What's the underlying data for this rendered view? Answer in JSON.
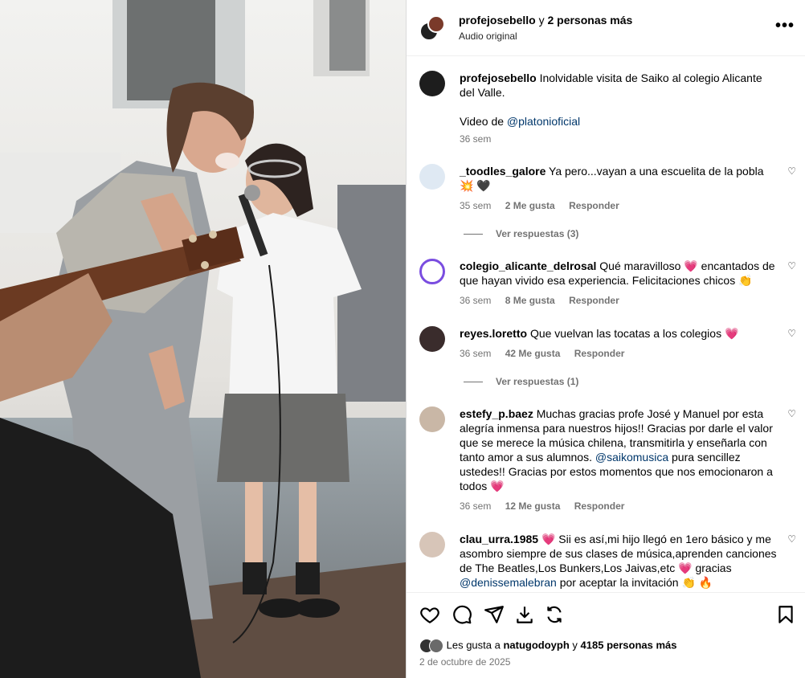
{
  "header": {
    "username": "profejosebello",
    "and_more": "y",
    "others": "2 personas más",
    "subtitle": "Audio original",
    "more_icon": "more-horizontal-icon"
  },
  "caption": {
    "username": "profejosebello",
    "text": "Inolvidable visita de Saiko al colegio Alicante del Valle.",
    "video_prefix": "Video de",
    "video_mention": "@platonioficial",
    "time": "36 sem"
  },
  "comments": [
    {
      "username": "_toodles_galore",
      "text": "Ya pero...vayan a una escuelita de la pobla",
      "emoji": "💥 🖤",
      "time": "35 sem",
      "likes": "2 Me gusta",
      "reply": "Responder",
      "view_replies": "Ver respuestas (3)"
    },
    {
      "username": "colegio_alicante_delrosal",
      "text": "Qué maravilloso",
      "emoji": "💗",
      "text2": "encantados de que hayan vivido esa experiencia. Felicitaciones chicos",
      "emoji2": "👏",
      "time": "36 sem",
      "likes": "8 Me gusta",
      "reply": "Responder"
    },
    {
      "username": "reyes.loretto",
      "text": "Que vuelvan las tocatas a los colegios",
      "emoji": "💗",
      "time": "36 sem",
      "likes": "42 Me gusta",
      "reply": "Responder",
      "view_replies": "Ver respuestas (1)"
    },
    {
      "username": "estefy_p.baez",
      "text": "Muchas gracias profe José y Manuel por esta alegría inmensa para nuestros hijos!! Gracias por darle el valor que se merece la música chilena, transmitirla y enseñarla con tanto amor a sus alumnos.",
      "mention": "@saikomusica",
      "text2": "pura sencillez ustedes!! Gracias por estos momentos que nos emocionaron a todos",
      "emoji": "💗",
      "time": "36 sem",
      "likes": "12 Me gusta",
      "reply": "Responder"
    },
    {
      "username": "clau_urra.1985",
      "emoji": "💗",
      "text": "Sii es así,mi hijo llegó en 1ero básico y me asombro siempre de sus clases de música,aprenden canciones de The Beatles,Los Bunkers,Los Jaivas,etc",
      "emoji2": "💗",
      "text2": "gracias",
      "mention": "@denissemalebran",
      "text3": "por aceptar la invitación",
      "emoji3": "👏 🔥"
    }
  ],
  "actions": {
    "like_icon": "heart-icon",
    "comment_icon": "comment-icon",
    "share_icon": "share-icon",
    "save_icon": "bookmark-icon",
    "download_icon": "download-icon",
    "repost_icon": "repost-icon"
  },
  "likes": {
    "prefix": "Les gusta a",
    "user": "natugodoyph",
    "and": "y",
    "count": "4185 personas más"
  },
  "date": "2 de octubre de 2025"
}
